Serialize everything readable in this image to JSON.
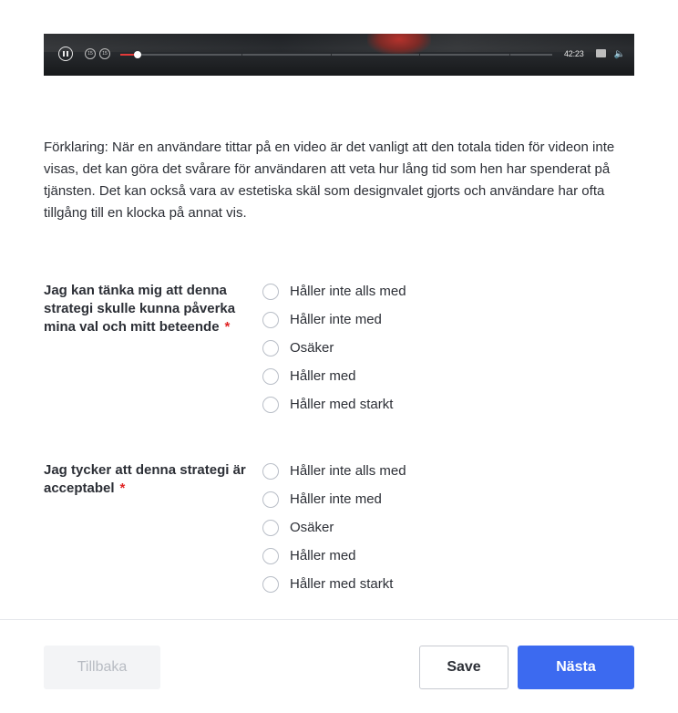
{
  "video": {
    "time": "42:23",
    "progress_fraction": 0.04,
    "segment_fractions": [
      0.28,
      0.487,
      0.693,
      0.9
    ],
    "skip_back_label": "15",
    "skip_fwd_label": "15",
    "icons": [
      "pause-icon",
      "skip-back-icon",
      "skip-forward-icon",
      "captions-icon",
      "volume-icon"
    ]
  },
  "explanation": "Förklaring: När en användare tittar på en video är det vanligt att den totala tiden för videon inte visas, det kan göra det svårare för användaren att veta hur lång tid som hen har spenderat på tjänsten. Det kan också vara av estetiska skäl som designvalet gjorts och användare har ofta tillgång till en klocka på annat vis.",
  "questions": [
    {
      "text": "Jag kan tänka mig att denna strategi skulle kunna påverka mina val och mitt beteende",
      "required_mark": "*",
      "options": [
        "Håller inte alls med",
        "Håller inte med",
        "Osäker",
        "Håller med",
        "Håller med starkt"
      ]
    },
    {
      "text": "Jag tycker att denna strategi är acceptabel",
      "required_mark": "*",
      "options": [
        "Håller inte alls med",
        "Håller inte med",
        "Osäker",
        "Håller med",
        "Håller med starkt"
      ]
    }
  ],
  "footer": {
    "back_label": "Tillbaka",
    "save_label": "Save",
    "next_label": "Nästa"
  },
  "colors": {
    "accent": "#3c6af0",
    "required": "#e02424",
    "progress": "#e33a3a"
  }
}
